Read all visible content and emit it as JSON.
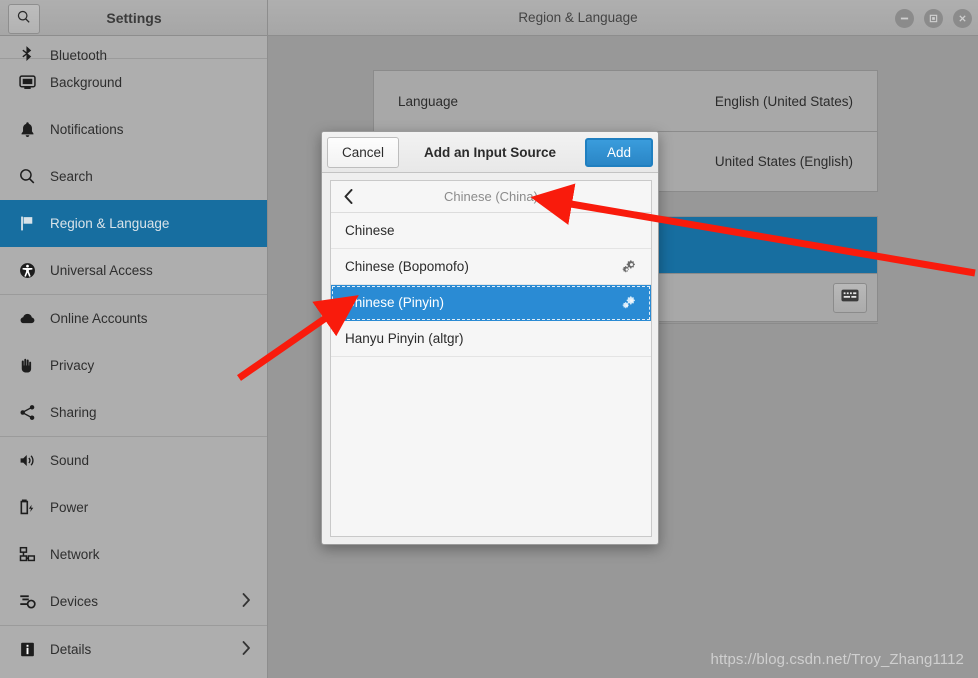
{
  "titlebar": {
    "settings_title": "Settings",
    "page_title": "Region & Language",
    "search_icon": "search-icon",
    "minimize_label": "−",
    "maximize_label": "■",
    "close_label": "✕"
  },
  "sidebar": {
    "items": [
      {
        "label": "Bluetooth",
        "icon": "bluetooth-icon",
        "selected": false,
        "chevron": false,
        "clipped": true,
        "separator_after": true
      },
      {
        "label": "Background",
        "icon": "background-icon",
        "selected": false,
        "chevron": false,
        "clipped": false,
        "separator_after": false
      },
      {
        "label": "Notifications",
        "icon": "bell-icon",
        "selected": false,
        "chevron": false,
        "clipped": false,
        "separator_after": false
      },
      {
        "label": "Search",
        "icon": "search-icon",
        "selected": false,
        "chevron": false,
        "clipped": false,
        "separator_after": false
      },
      {
        "label": "Region & Language",
        "icon": "flag-icon",
        "selected": true,
        "chevron": false,
        "clipped": false,
        "separator_after": false
      },
      {
        "label": "Universal Access",
        "icon": "accessibility-icon",
        "selected": false,
        "chevron": false,
        "clipped": false,
        "separator_after": true
      },
      {
        "label": "Online Accounts",
        "icon": "cloud-icon",
        "selected": false,
        "chevron": false,
        "clipped": false,
        "separator_after": false
      },
      {
        "label": "Privacy",
        "icon": "hand-icon",
        "selected": false,
        "chevron": false,
        "clipped": false,
        "separator_after": false
      },
      {
        "label": "Sharing",
        "icon": "share-icon",
        "selected": false,
        "chevron": false,
        "clipped": false,
        "separator_after": true
      },
      {
        "label": "Sound",
        "icon": "speaker-icon",
        "selected": false,
        "chevron": false,
        "clipped": false,
        "separator_after": false
      },
      {
        "label": "Power",
        "icon": "power-battery-icon",
        "selected": false,
        "chevron": false,
        "clipped": false,
        "separator_after": false
      },
      {
        "label": "Network",
        "icon": "network-icon",
        "selected": false,
        "chevron": false,
        "clipped": false,
        "separator_after": false
      },
      {
        "label": "Devices",
        "icon": "devices-icon",
        "selected": false,
        "chevron": true,
        "clipped": false,
        "separator_after": true
      },
      {
        "label": "Details",
        "icon": "info-icon",
        "selected": false,
        "chevron": true,
        "clipped": false,
        "separator_after": false
      }
    ]
  },
  "main": {
    "language_row": {
      "label": "Language",
      "value": "English (United States)"
    },
    "input_source_row": {
      "value": "United States (English)"
    },
    "keyboard_button_icon": "keyboard-icon"
  },
  "dialog": {
    "cancel_label": "Cancel",
    "title": "Add an Input Source",
    "add_label": "Add",
    "back_icon": "chevron-left-icon",
    "list_title": "Chinese (China)",
    "rows": [
      {
        "label": "Chinese",
        "gear": false,
        "selected": false
      },
      {
        "label": "Chinese (Bopomofo)",
        "gear": true,
        "selected": false
      },
      {
        "label": "Chinese (Pinyin)",
        "gear": true,
        "selected": true
      },
      {
        "label": "Hanyu Pinyin (altgr)",
        "gear": false,
        "selected": false
      }
    ]
  },
  "annotations": {
    "arrow_color": "#f91b0c",
    "arrow_1_target": "Chinese (China)",
    "arrow_2_target": "Chinese (Pinyin)"
  },
  "watermark": {
    "text": "https://blog.csdn.net/Troy_Zhang1112"
  },
  "colors": {
    "accent_blue": "#2a8bd4",
    "selected_sidebar_blue": "#176ea0",
    "window_bg": "#989898",
    "sidebar_bg": "#aeaeae",
    "dialog_bg": "#efefef"
  }
}
